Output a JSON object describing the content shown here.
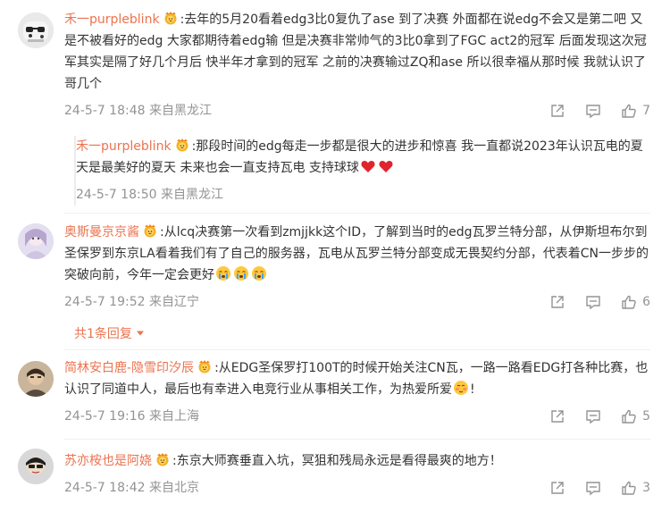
{
  "comments": [
    {
      "username": "禾一purpleblink",
      "text": ":去年的5月20看着edg3比0复仇了ase 到了决赛 外面都在说edg不会又是第二吧 又是不被看好的edg 大家都期待着edg输 但是决赛非常帅气的3比0拿到了FGC act2的冠军 后面发现这次冠军其实是隔了好几个月后 快半年才拿到的冠军 之前的决赛输过ZQ和ase 所以很幸福从那时候 我就认识了哥几个",
      "time": "24-5-7 18:48 来自黑龙江",
      "likes": "7",
      "reply": {
        "username": "禾一purpleblink",
        "text": ":那段时间的edg每走一步都是很大的进步和惊喜 我一直都说2023年认识瓦电的夏天是最美好的夏天 未来也会一直支持瓦电 支持球球",
        "time": "24-5-7 18:50 来自黑龙江"
      }
    },
    {
      "username": "奥斯曼京京酱",
      "text": ":从lcq决赛第一次看到zmjjkk这个ID，了解到当时的edg瓦罗兰特分部，从伊斯坦布尔到圣保罗到东京LA看着我们有了自己的服务器，瓦电从瓦罗兰特分部变成无畏契约分部，代表着CN一步步的突破向前，今年一定会更好",
      "time": "24-5-7 19:52 来自辽宁",
      "likes": "6",
      "more_replies": "共1条回复"
    },
    {
      "username": "简林安白鹿-隐雪印汐辰",
      "text": ":从EDG圣保罗打100T的时候开始关注CN瓦，一路一路看EDG打各种比赛，也认识了同道中人，最后也有幸进入电竞行业从事相关工作，为热爱所爱",
      "text_end": "!",
      "time": "24-5-7 19:16 来自上海",
      "likes": "5"
    },
    {
      "username": "苏亦桉也是阿娆",
      "text": ":东京大师赛垂直入坑，冥狙和残局永远是看得最爽的地方！",
      "time": "24-5-7 18:42 来自北京",
      "likes": "3"
    }
  ],
  "colors": {
    "username": "#eb7350",
    "meta": "#939393",
    "text": "#333333"
  },
  "icons": {
    "share": "share-icon",
    "comment": "comment-icon",
    "like": "thumbs-up-icon",
    "badge": "lion-fan-badge-icon",
    "heart": "red-heart-emoji",
    "cry": "crying-emoji",
    "blush": "shy-emoji"
  }
}
